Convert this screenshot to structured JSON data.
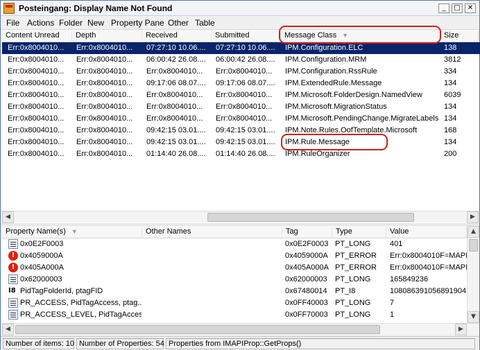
{
  "window": {
    "title": "Posteingang: Display Name Not Found"
  },
  "menu": [
    "File",
    "Actions",
    "Folder",
    "New",
    "Property Pane",
    "Other",
    "Table"
  ],
  "top_table": {
    "columns": [
      "Content Unread",
      "Depth",
      "Received",
      "Submitted",
      "Message Class",
      "Size"
    ],
    "rows": [
      [
        "Err:0x8004010...",
        "Err:0x8004010...",
        "07:27:10 10.06....",
        "07:27:10 10.06....",
        "IPM.Configuration.ELC",
        "138"
      ],
      [
        "Err:0x8004010...",
        "Err:0x8004010...",
        "06:00:42 26.08....",
        "06:00:42 26.08....",
        "IPM.Configuration.MRM",
        "3812"
      ],
      [
        "Err:0x8004010...",
        "Err:0x8004010...",
        "Err:0x8004010...",
        "Err:0x8004010...",
        "IPM.Configuration.RssRule",
        "334"
      ],
      [
        "Err:0x8004010...",
        "Err:0x8004010...",
        "09:17:06 08.07....",
        "09:17:06 08.07....",
        "IPM.ExtendedRule.Message",
        "134"
      ],
      [
        "Err:0x8004010...",
        "Err:0x8004010...",
        "Err:0x8004010...",
        "Err:0x8004010...",
        "IPM.Microsoft.FolderDesign.NamedView",
        "6039"
      ],
      [
        "Err:0x8004010...",
        "Err:0x8004010...",
        "Err:0x8004010...",
        "Err:0x8004010...",
        "IPM.Microsoft.MigrationStatus",
        "134"
      ],
      [
        "Err:0x8004010...",
        "Err:0x8004010...",
        "Err:0x8004010...",
        "Err:0x8004010...",
        "IPM.Microsoft.PendingChange.MigrateLabels",
        "134"
      ],
      [
        "Err:0x8004010...",
        "Err:0x8004010...",
        "09:42:15 03.01....",
        "09:42:15 03.01....",
        "IPM.Note.Rules.OofTemplate.Microsoft",
        "168"
      ],
      [
        "Err:0x8004010...",
        "Err:0x8004010...",
        "09:42:15 03.01....",
        "09:42:15 03.01....",
        "IPM.Rule.Message",
        "134"
      ],
      [
        "Err:0x8004010...",
        "Err:0x8004010...",
        "01:14:40 26.08....",
        "01:14:40 26.08....",
        "IPM.RuleOrganizer",
        "200"
      ]
    ]
  },
  "bottom_table": {
    "columns": [
      "Property Name(s)",
      "Other Names",
      "Tag",
      "Type",
      "Value"
    ],
    "rows": [
      {
        "icon": "multi-value-icon",
        "name": "0x0E2F0003",
        "other": "",
        "tag": "0x0E2F0003",
        "type": "PT_LONG",
        "value": "401"
      },
      {
        "icon": "error-icon",
        "name": "0x4059000A",
        "other": "",
        "tag": "0x4059000A",
        "type": "PT_ERROR",
        "value": "Err:0x8004010F=MAPI_"
      },
      {
        "icon": "error-icon",
        "name": "0x405A000A",
        "other": "",
        "tag": "0x405A000A",
        "type": "PT_ERROR",
        "value": "Err:0x8004010F=MAPI_"
      },
      {
        "icon": "multi-value-icon",
        "name": "0x62000003",
        "other": "",
        "tag": "0x62000003",
        "type": "PT_LONG",
        "value": "165849236"
      },
      {
        "icon": "i8-icon",
        "name": "PidTagFolderId, ptagFID",
        "other": "",
        "tag": "0x67480014",
        "type": "PT_I8",
        "value": "108086391056891904"
      },
      {
        "icon": "multi-value-icon",
        "name": "PR_ACCESS, PidTagAccess, ptag...",
        "other": "",
        "tag": "0x0FF40003",
        "type": "PT_LONG",
        "value": "7"
      },
      {
        "icon": "multi-value-icon",
        "name": "PR_ACCESS_LEVEL, PidTagAccess...",
        "other": "",
        "tag": "0x0FF70003",
        "type": "PT_LONG",
        "value": "1"
      }
    ]
  },
  "status": {
    "items": "Number of items: 10",
    "props": "Number of Properties: 54",
    "source": "Properties from IMAPIProp::GetProps()"
  },
  "colors": {
    "selection": "#0a246a",
    "annotation": "#d0201a"
  }
}
